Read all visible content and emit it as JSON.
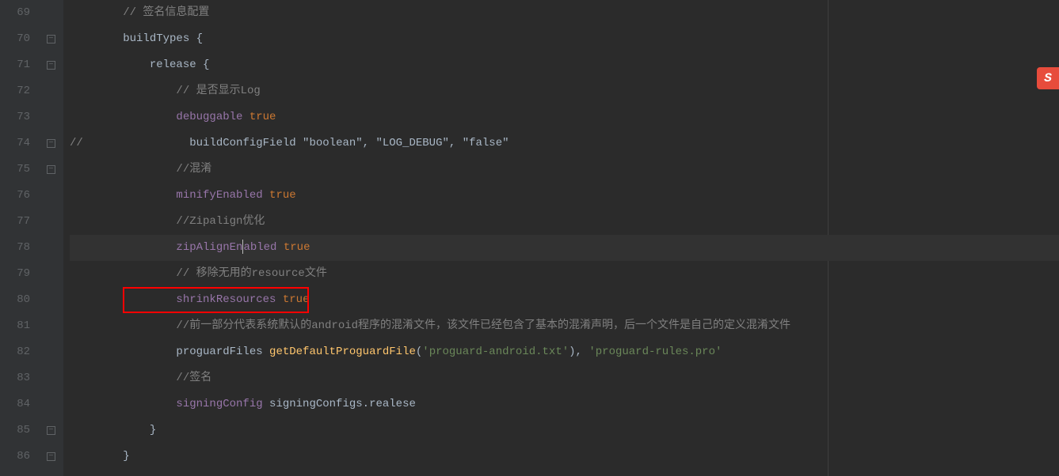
{
  "lineNumbers": [
    "69",
    "70",
    "71",
    "72",
    "73",
    "74",
    "75",
    "76",
    "77",
    "78",
    "79",
    "80",
    "81",
    "82",
    "83",
    "84",
    "85",
    "86"
  ],
  "code": {
    "line69": {
      "indent": "        ",
      "comment": "// 签名信息配置"
    },
    "line70": {
      "indent": "        ",
      "text": "buildTypes {"
    },
    "line71": {
      "indent": "            ",
      "text": "release {"
    },
    "line72": {
      "indent": "                ",
      "comment": "// 是否显示Log"
    },
    "line73": {
      "indent": "                ",
      "property": "debuggable",
      "space": " ",
      "value": "true"
    },
    "line74": {
      "prefix": "//",
      "indent": "                ",
      "text": "buildConfigField \"boolean\", \"LOG_DEBUG\", \"false\""
    },
    "line75": {
      "indent": "                ",
      "comment": "//混淆"
    },
    "line76": {
      "indent": "                ",
      "property": "minifyEnabled",
      "space": " ",
      "value": "true"
    },
    "line77": {
      "indent": "                ",
      "comment": "//Zipalign优化"
    },
    "line78": {
      "indent": "                ",
      "propertyPart1": "zipAlignEn",
      "propertyPart2": "abled",
      "space": " ",
      "value": "true"
    },
    "line79": {
      "indent": "                ",
      "comment": "// 移除无用的resource文件"
    },
    "line80": {
      "indent": "                ",
      "property": "shrinkResources",
      "space": " ",
      "value": "true"
    },
    "line81": {
      "indent": "                ",
      "comment": "//前一部分代表系统默认的android程序的混淆文件，该文件已经包含了基本的混淆声明，后一个文件是自己的定义混淆文件"
    },
    "line82": {
      "indent": "                ",
      "text1": "proguardFiles ",
      "method": "getDefaultProguardFile",
      "paren1": "(",
      "string1": "'proguard-android.txt'",
      "paren2": ")",
      "text2": ", ",
      "string2": "'proguard-rules.pro'"
    },
    "line83": {
      "indent": "                ",
      "comment": "//签名"
    },
    "line84": {
      "indent": "                ",
      "property": "signingConfig",
      "space": " ",
      "text": "signingConfigs.realese"
    },
    "line85": {
      "indent": "            ",
      "text": "}"
    },
    "line86": {
      "indent": "        ",
      "text": "}"
    }
  },
  "badge": "S"
}
